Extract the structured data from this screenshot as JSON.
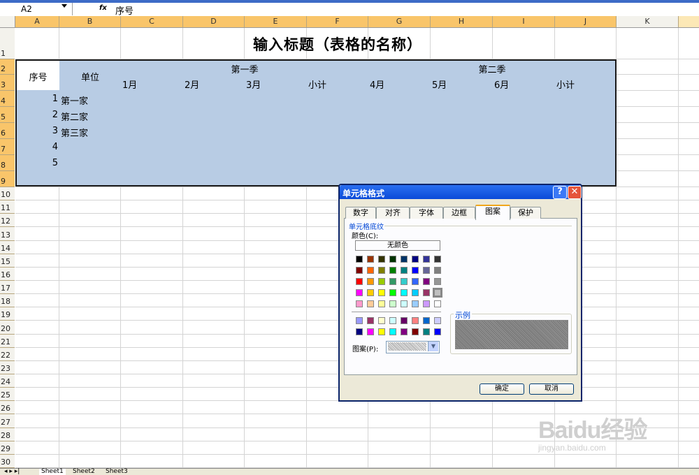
{
  "formula_bar": {
    "name_box": "A2",
    "fx": "fx",
    "content": "序号"
  },
  "columns": [
    "A",
    "B",
    "C",
    "D",
    "E",
    "F",
    "G",
    "H",
    "I",
    "J",
    "K"
  ],
  "rows": [
    "1",
    "2",
    "3",
    "4",
    "5",
    "6",
    "7",
    "8",
    "9",
    "10",
    "11",
    "12",
    "13",
    "14",
    "15",
    "16",
    "17",
    "18",
    "19",
    "20",
    "21",
    "22",
    "23",
    "24",
    "25",
    "26",
    "27",
    "28",
    "29",
    "30"
  ],
  "sheet": {
    "title": "输入标题（表格的名称）",
    "header_seq": "序号",
    "header_unit": "单位",
    "q1": "第一季",
    "q2": "第二季",
    "months": [
      "1月",
      "2月",
      "3月",
      "小计",
      "4月",
      "5月",
      "6月",
      "小计"
    ],
    "data_rows": [
      {
        "n": "1",
        "name": "第一家"
      },
      {
        "n": "2",
        "name": "第二家"
      },
      {
        "n": "3",
        "name": "第三家"
      },
      {
        "n": "4",
        "name": ""
      },
      {
        "n": "5",
        "name": ""
      }
    ]
  },
  "sheet_tabs": [
    "Sheet1",
    "Sheet2",
    "Sheet3"
  ],
  "dialog": {
    "title": "单元格格式",
    "help": "?",
    "close": "✕",
    "tabs": [
      "数字",
      "对齐",
      "字体",
      "边框",
      "图案",
      "保护"
    ],
    "active_tab": "图案",
    "section": "单元格底纹",
    "color_label": "颜色(C):",
    "no_color": "无颜色",
    "pattern_label": "图案(P):",
    "sample_label": "示例",
    "ok": "确定",
    "cancel": "取消",
    "palette": [
      [
        "#000000",
        "#993300",
        "#333300",
        "#003300",
        "#003366",
        "#000080",
        "#333399",
        "#333333"
      ],
      [
        "#800000",
        "#ff6600",
        "#808000",
        "#008000",
        "#008080",
        "#0000ff",
        "#666699",
        "#808080"
      ],
      [
        "#ff0000",
        "#ff9900",
        "#99cc00",
        "#339966",
        "#33cccc",
        "#3366ff",
        "#800080",
        "#969696"
      ],
      [
        "#ff00ff",
        "#ffcc00",
        "#ffff00",
        "#00ff00",
        "#00ffff",
        "#00ccff",
        "#993366",
        "#c0c0c0"
      ],
      [
        "#ff99cc",
        "#ffcc99",
        "#ffff99",
        "#ccffcc",
        "#ccffff",
        "#99ccff",
        "#cc99ff",
        "#ffffff"
      ],
      [
        "#9999ff",
        "#993366",
        "#ffffcc",
        "#ccffff",
        "#660066",
        "#ff8080",
        "#0066cc",
        "#ccccff"
      ],
      [
        "#000080",
        "#ff00ff",
        "#ffff00",
        "#00ffff",
        "#800080",
        "#800000",
        "#008080",
        "#0000ff"
      ]
    ]
  },
  "watermark": {
    "main": "Baidu经验",
    "sub": "jingyan.baidu.com"
  },
  "colors": {
    "selection_fill": "#b8cce4",
    "header_selected": "#f9c56a",
    "titlebar": "#0a4ad8"
  }
}
